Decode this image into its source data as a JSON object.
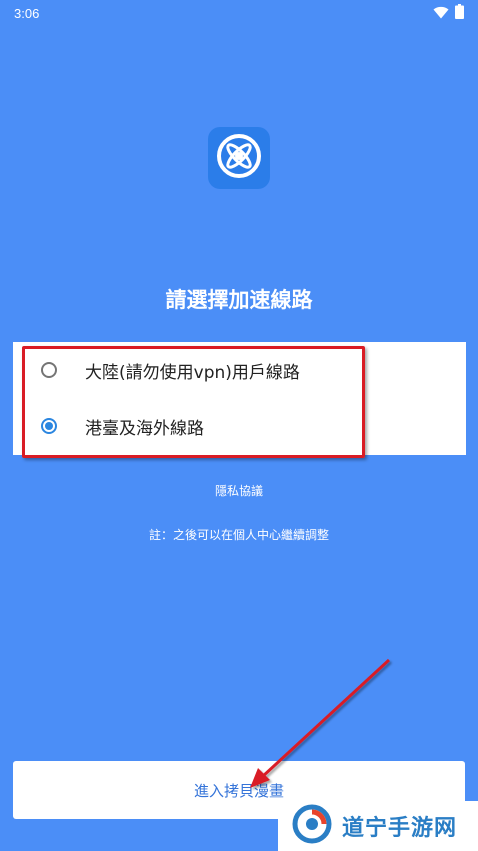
{
  "status_bar": {
    "time": "3:06",
    "icons": [
      "wifi-icon",
      "battery-icon"
    ]
  },
  "app": {
    "logo_icon": "app-logo-icon"
  },
  "heading": "請選擇加速線路",
  "route_options": [
    {
      "label": "大陸(請勿使用vpn)用戶線路",
      "selected": false
    },
    {
      "label": "港臺及海外線路",
      "selected": true
    }
  ],
  "privacy_link": "隱私協議",
  "note": "註：之後可以在個人中心繼續調整",
  "enter_button": "進入拷貝漫畫",
  "watermark": {
    "text": "道宁手游网"
  },
  "colors": {
    "background": "#4b8ef7",
    "accent": "#2b86e0",
    "annotation_red": "#d91c25",
    "button_text": "#3574d9"
  }
}
